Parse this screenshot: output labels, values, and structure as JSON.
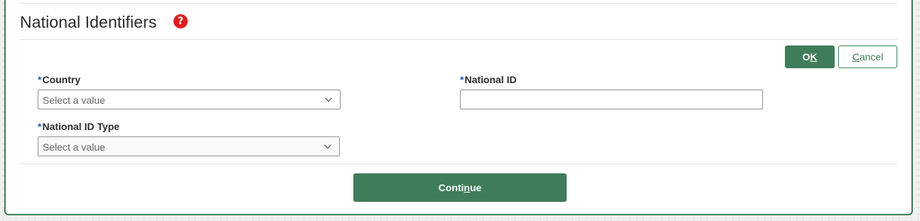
{
  "dialog": {
    "title": "National Identifiers",
    "help_icon": "question-mark-icon",
    "ok_label_pre": "O",
    "ok_label_key": "K",
    "ok_label_post": "",
    "cancel_label_pre": "",
    "cancel_label_key": "C",
    "cancel_label_post": "ancel"
  },
  "form": {
    "required_marker": "*",
    "country": {
      "label": "Country",
      "value": "Select a value"
    },
    "national_id": {
      "label": "National ID",
      "value": ""
    },
    "national_id_type": {
      "label": "National ID Type",
      "value": "Select a value"
    }
  },
  "footer": {
    "continue_label_pre": "Conti",
    "continue_label_key": "n",
    "continue_label_post": "ue"
  },
  "colors": {
    "accent": "#3f7d5a",
    "help": "#e01e1e",
    "required": "#1c5fb8"
  }
}
